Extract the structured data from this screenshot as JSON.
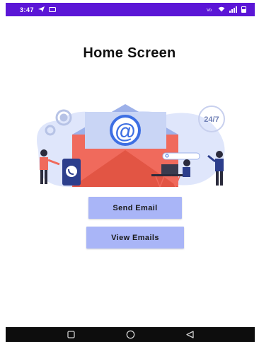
{
  "status_bar": {
    "time": "3:47",
    "left_icons": [
      "send-icon",
      "message-icon"
    ],
    "right_icons": [
      "volte-icon",
      "wifi-icon",
      "signal-icon",
      "battery-icon"
    ],
    "color": "#5b16d6"
  },
  "screen": {
    "title": "Home Screen"
  },
  "illustration": {
    "badge_text": "24/7",
    "at_symbol": "@"
  },
  "buttons": {
    "send_email": "Send Email",
    "view_emails": "View Emails",
    "color": "#a9b5f7"
  },
  "nav_bar": {
    "items": [
      "recents-icon",
      "home-icon",
      "back-icon"
    ]
  }
}
